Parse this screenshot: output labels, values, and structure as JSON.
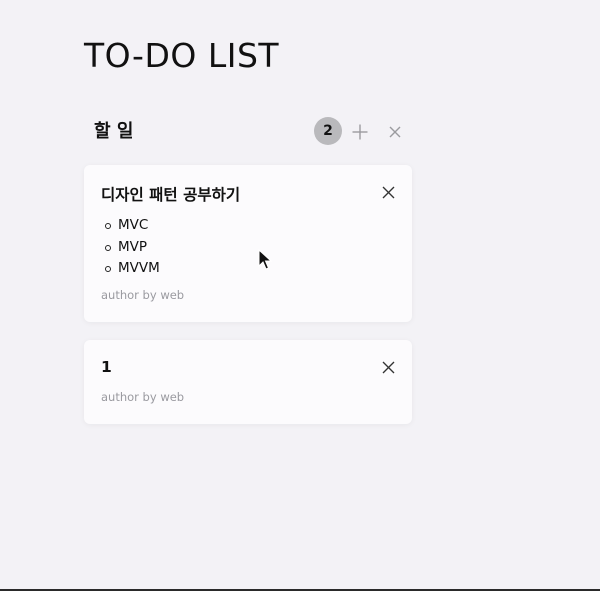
{
  "app": {
    "title": "TO-DO LIST"
  },
  "column": {
    "title": "할 일",
    "count": "2",
    "add_icon": "plus-icon",
    "clear_icon": "close-icon"
  },
  "cards": [
    {
      "title": "디자인 패턴 공부하기",
      "items": [
        "MVC",
        "MVP",
        "MVVM"
      ],
      "author": "author by web",
      "close_icon": "close-icon"
    },
    {
      "title": "1",
      "items": [],
      "author": "author by web",
      "close_icon": "close-icon"
    }
  ],
  "colors": {
    "background": "#f3f2f6",
    "card": "#fcfbfd",
    "badge": "#b9b9bc",
    "muted_text": "#9a9aa0"
  }
}
